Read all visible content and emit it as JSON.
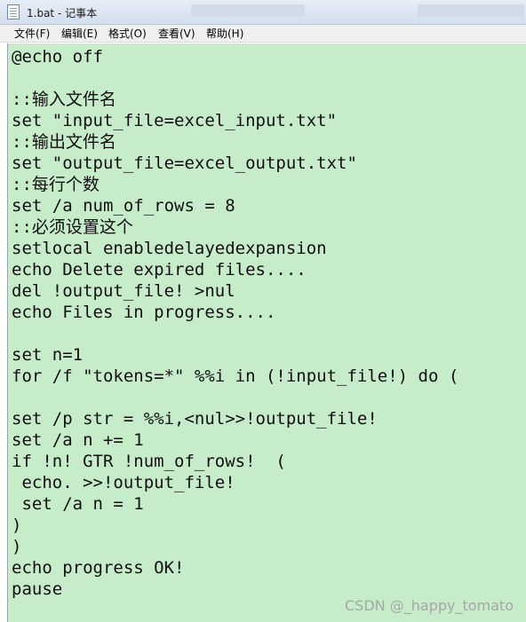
{
  "window": {
    "title": "1.bat - 记事本"
  },
  "menu": [
    "文件(F)",
    "编辑(E)",
    "格式(O)",
    "查看(V)",
    "帮助(H)"
  ],
  "editor": {
    "lines": [
      "@echo off",
      "",
      "::输入文件名",
      "set \"input_file=excel_input.txt\"",
      "::输出文件名",
      "set \"output_file=excel_output.txt\"",
      "::每行个数",
      "set /a num_of_rows = 8",
      "::必须设置这个",
      "setlocal enabledelayedexpansion",
      "echo Delete expired files....",
      "del !output_file! >nul",
      "echo Files in progress....",
      "",
      "set n=1",
      "for /f \"tokens=*\" %%i in (!input_file!) do (",
      "",
      "set /p str = %%i,<nul>>!output_file!",
      "set /a n += 1",
      "if !n! GTR !num_of_rows!  (",
      " echo. >>!output_file!",
      " set /a n = 1",
      ")",
      ")",
      "echo progress OK!",
      "pause"
    ]
  },
  "watermark": "CSDN @_happy_tomato"
}
